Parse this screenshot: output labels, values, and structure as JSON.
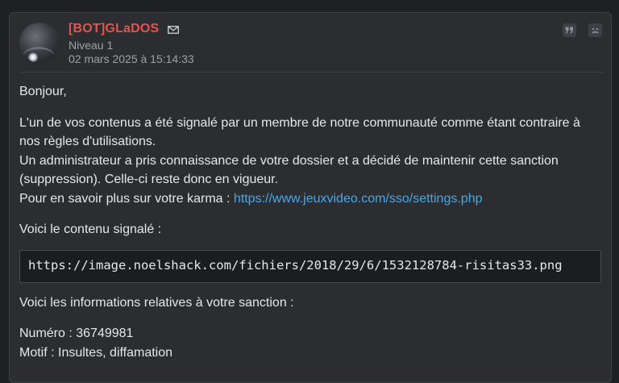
{
  "post": {
    "author": "[BOT]GLaDOS",
    "level": "Niveau 1",
    "date": "02 mars 2025 à 15:14:33",
    "icons": {
      "message": "mail-icon",
      "quote": "quote-icon",
      "report": "frown-icon"
    }
  },
  "message": {
    "greeting": "Bonjour,",
    "line1": "L'un de vos contenus a été signalé par un membre de notre communauté comme étant contraire à nos règles d'utilisations.",
    "line2": "Un administrateur a pris connaissance de votre dossier et a décidé de maintenir cette sanction (suppression). Celle-ci reste donc en vigueur.",
    "karma_prefix": "Pour en savoir plus sur votre karma : ",
    "karma_link": "https://www.jeuxvideo.com/sso/settings.php",
    "reported_label": "Voici le contenu signalé :",
    "reported_content": "https://image.noelshack.com/fichiers/2018/29/6/1532128784-risitas33.png",
    "sanction_label": "Voici les informations relatives à votre sanction :",
    "numero": "Numéro : 36749981",
    "motif": "Motif : Insultes, diffamation"
  },
  "colors": {
    "author": "#e3544c",
    "link": "#4aa8e8",
    "background": "#2b2d31"
  }
}
